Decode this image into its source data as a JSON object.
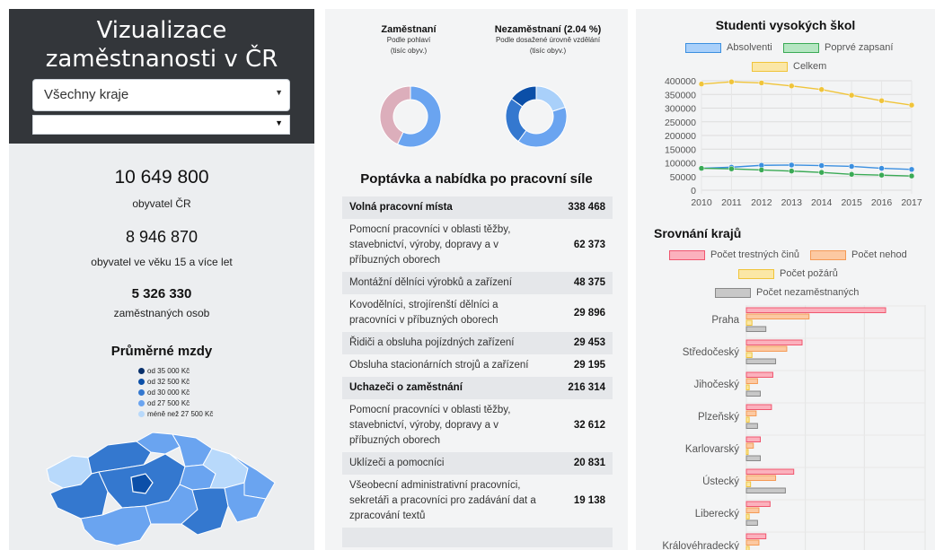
{
  "header": {
    "title_line1": "Vizualizace",
    "title_line2": "zaměstnanosti v ČR",
    "region_select": "Všechny kraje",
    "second_select": ""
  },
  "stats": {
    "population": "10 649 800",
    "population_label": "obyvatel ČR",
    "adults": "8 946 870",
    "adults_label": "obyvatel ve věku 15 a více let",
    "employed": "5 326 330",
    "employed_label": "zaměstnaných osob"
  },
  "wages": {
    "title": "Průměrné mzdy",
    "legend": [
      {
        "label": "od 35 000 Kč",
        "color": "#08306b"
      },
      {
        "label": "od 32 500 Kč",
        "color": "#0b4fa8"
      },
      {
        "label": "od 30 000 Kč",
        "color": "#3478cf"
      },
      {
        "label": "od 27 500 Kč",
        "color": "#6aa4f0"
      },
      {
        "label": "méně než 27 500 Kč",
        "color": "#b8d9fb"
      }
    ]
  },
  "donuts": {
    "employed": {
      "title": "Zaměstnaní",
      "sub1": "Podle pohlaví",
      "sub2": "(tisíc obyv.)",
      "slices": [
        {
          "value": 57,
          "color": "#6aa4f0"
        },
        {
          "value": 43,
          "color": "#dcaebb"
        }
      ]
    },
    "unemployed": {
      "title": "Nezaměstnaní (2.04 %)",
      "sub1": "Podle dosažené úrovně vzdělání",
      "sub2": "(tisíc obyv.)",
      "slices": [
        {
          "value": 20,
          "color": "#a9d0fa"
        },
        {
          "value": 40,
          "color": "#6aa4f0"
        },
        {
          "value": 25,
          "color": "#3478cf"
        },
        {
          "value": 15,
          "color": "#0b4fa8"
        }
      ]
    }
  },
  "labor": {
    "title": "Poptávka a nabídka po pracovní síle",
    "rows": [
      {
        "label": "Volná pracovní místa",
        "value": "338 468",
        "head": true
      },
      {
        "label": "Pomocní pracovníci v oblasti těžby, stavebnictví, výroby, dopravy a v příbuzných oborech",
        "value": "62 373"
      },
      {
        "label": "Montážní dělníci výrobků a zařízení",
        "value": "48 375"
      },
      {
        "label": "Kovodělníci, strojírenští dělníci a pracovníci v příbuzných oborech",
        "value": "29 896"
      },
      {
        "label": "Řidiči a obsluha pojízdných zařízení",
        "value": "29 453"
      },
      {
        "label": "Obsluha stacionárních strojů a zařízení",
        "value": "29 195"
      },
      {
        "label": "Uchazeči o zaměstnání",
        "value": "216 314",
        "head": true
      },
      {
        "label": "Pomocní pracovníci v oblasti těžby, stavebnictví, výroby, dopravy a v příbuzných oborech",
        "value": "32 612"
      },
      {
        "label": "Uklízeči a pomocníci",
        "value": "20 831"
      },
      {
        "label": "Všeobecní administrativní pracovníci, sekretáři a pracovníci pro zadávání dat a zpracování textů",
        "value": "19 138"
      },
      {
        "label": "",
        "value": ""
      }
    ]
  },
  "chart_data": [
    {
      "type": "line",
      "title": "Studenti vysokých škol",
      "x": [
        2010,
        2011,
        2012,
        2013,
        2014,
        2015,
        2016,
        2017
      ],
      "ylim": [
        0,
        400000
      ],
      "yticks": [
        "0",
        "50000",
        "100000",
        "150000",
        "200000",
        "250000",
        "300000",
        "350000",
        "400000"
      ],
      "grid": true,
      "legend": "top",
      "series": [
        {
          "name": "Absolventi",
          "color": "#3b8fe0",
          "fill": "#a9d0fa",
          "values": [
            80000,
            84000,
            91000,
            92000,
            90000,
            87000,
            80000,
            76000
          ]
        },
        {
          "name": "Poprvé zapsaní",
          "color": "#3aaa55",
          "fill": "#b5e6c2",
          "values": [
            80000,
            78000,
            74000,
            70000,
            65000,
            58000,
            55000,
            52000
          ]
        },
        {
          "name": "Celkem",
          "color": "#f0c43a",
          "fill": "#fbe7a6",
          "values": [
            388000,
            396000,
            392000,
            381000,
            368000,
            347000,
            327000,
            311000
          ]
        }
      ]
    },
    {
      "type": "bar",
      "title": "Srovnání krajů",
      "orientation": "horizontal",
      "legend": "top",
      "categories": [
        "Praha",
        "Středočeský",
        "Jihočeský",
        "Plzeňský",
        "Karlovarský",
        "Ústecký",
        "Liberecký",
        "Královéhradecký"
      ],
      "xmax": 100,
      "series": [
        {
          "name": "Počet trestných činů",
          "color": "#f0566f",
          "fill": "#fbb1bd",
          "values": [
            100,
            40,
            19,
            18,
            10,
            34,
            17,
            14
          ]
        },
        {
          "name": "Počet nehod",
          "color": "#f59a55",
          "fill": "#fcc9a2",
          "values": [
            45,
            29,
            8,
            7,
            5,
            21,
            9,
            9
          ]
        },
        {
          "name": "Počet požárů",
          "color": "#f0c43a",
          "fill": "#fbe7a6",
          "values": [
            4,
            4,
            2,
            2,
            1,
            3,
            2,
            2
          ]
        },
        {
          "name": "Počet nezaměstnaných",
          "color": "#888888",
          "fill": "#c8c8c8",
          "values": [
            14,
            21,
            10,
            8,
            10,
            28,
            8,
            10
          ]
        }
      ]
    }
  ]
}
